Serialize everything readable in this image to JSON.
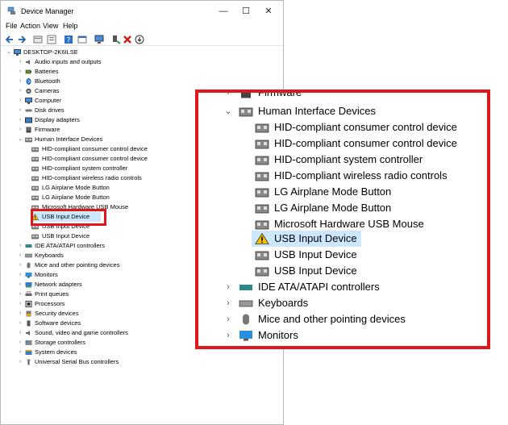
{
  "window": {
    "title": "Device Manager",
    "minimize_glyph": "—",
    "maximize_glyph": "☐",
    "close_glyph": "✕"
  },
  "menu": [
    "File",
    "Action",
    "View",
    "Help"
  ],
  "toolbar_icons": [
    "back-icon",
    "forward-icon",
    "properties-icon",
    "update-driver-icon",
    "help-icon",
    "view-icon",
    "monitor-icon",
    "enable-icon",
    "uninstall-icon",
    "scan-icon"
  ],
  "colors": {
    "accent_red": "#e0161b",
    "selection": "#cce8ff"
  },
  "tree": {
    "root": "DESKTOP-2K6ILSE",
    "categories": [
      "Audio inputs and outputs",
      "Batteries",
      "Bluetooth",
      "Cameras",
      "Computer",
      "Disk drives",
      "Display adapters",
      "Firmware"
    ],
    "expanded": "Human Interface Devices",
    "hid_children": [
      "HID-compliant consumer control device",
      "HID-compliant consumer control device",
      "HID-compliant system controller",
      "HID-compliant wireless radio controls",
      "LG Airplane Mode Button",
      "LG Airplane Mode Button",
      "Microsoft Hardware USB Mouse",
      "USB Input Device",
      "USB Input Device",
      "USB Input Device"
    ],
    "categories_after": [
      "IDE ATA/ATAPI controllers",
      "Keyboards",
      "Mice and other pointing devices",
      "Monitors",
      "Network adapters",
      "Print queues",
      "Processors",
      "Security devices",
      "Software devices",
      "Sound, video and game controllers",
      "Storage controllers",
      "System devices",
      "Universal Serial Bus controllers"
    ]
  },
  "zoom": {
    "partial_top": "Firmware",
    "expanded": "Human Interface Devices",
    "children": [
      "HID-compliant consumer control device",
      "HID-compliant consumer control device",
      "HID-compliant system controller",
      "HID-compliant wireless radio controls",
      "LG Airplane Mode Button",
      "LG Airplane Mode Button",
      "Microsoft Hardware USB Mouse",
      "USB Input Device",
      "USB Input Device",
      "USB Input Device"
    ],
    "after": [
      "IDE ATA/ATAPI controllers",
      "Keyboards",
      "Mice and other pointing devices",
      "Monitors"
    ]
  }
}
